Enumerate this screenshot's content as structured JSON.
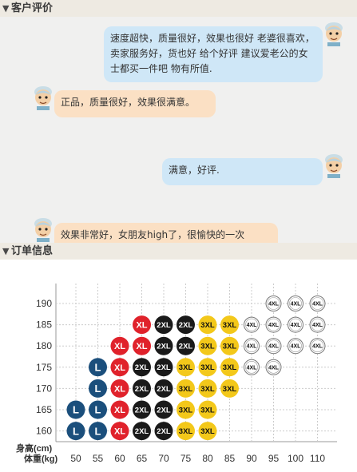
{
  "reviews_section": {
    "title": "客户评价"
  },
  "orders_section": {
    "title": "订单信息"
  },
  "reviews": [
    {
      "side": "right",
      "color": "blue",
      "text": "速度超快，质量很好，效果也很好 老婆很喜欢，卖家服务好，货也好 给个好评 建议爱老公的女士都买一件吧 物有所值."
    },
    {
      "side": "left",
      "color": "orange",
      "text": "正品，质量很好，效果很满意。"
    },
    {
      "side": "right",
      "color": "blue",
      "text": "满意，好评."
    },
    {
      "side": "left",
      "color": "orange",
      "text": "效果非常好，女朋友high了，很愉快的一次"
    }
  ],
  "chart_data": {
    "type": "table",
    "title": "",
    "xlabel": "体重(kg)",
    "ylabel": "身高(cm)",
    "x": [
      50,
      55,
      60,
      65,
      70,
      75,
      80,
      85,
      90,
      95,
      100,
      110
    ],
    "y": [
      160,
      165,
      170,
      175,
      180,
      185,
      190
    ],
    "size_colors": {
      "L": "#1b4f7c",
      "XL": "#e0222b",
      "2XL": "#1a1a1a",
      "3XL": "#f3c81a",
      "4XL": "#ffffff"
    },
    "rows": [
      {
        "height": 190,
        "sizes": [
          "",
          "",
          "",
          "",
          "",
          "",
          "",
          "",
          "",
          "4XL",
          "4XL",
          "4XL"
        ]
      },
      {
        "height": 185,
        "sizes": [
          "",
          "",
          "",
          "XL",
          "2XL",
          "2XL",
          "3XL",
          "3XL",
          "4XL",
          "4XL",
          "4XL",
          "4XL"
        ]
      },
      {
        "height": 180,
        "sizes": [
          "",
          "",
          "XL",
          "XL",
          "2XL",
          "2XL",
          "3XL",
          "3XL",
          "4XL",
          "4XL",
          "4XL",
          "4XL"
        ]
      },
      {
        "height": 175,
        "sizes": [
          "",
          "L",
          "XL",
          "2XL",
          "2XL",
          "3XL",
          "3XL",
          "3XL",
          "4XL",
          "4XL",
          "",
          ""
        ]
      },
      {
        "height": 170,
        "sizes": [
          "",
          "L",
          "XL",
          "2XL",
          "2XL",
          "3XL",
          "3XL",
          "3XL",
          "",
          "",
          "",
          ""
        ]
      },
      {
        "height": 165,
        "sizes": [
          "L",
          "L",
          "XL",
          "2XL",
          "2XL",
          "3XL",
          "3XL",
          "",
          "",
          "",
          "",
          ""
        ]
      },
      {
        "height": 160,
        "sizes": [
          "L",
          "L",
          "XL",
          "2XL",
          "2XL",
          "3XL",
          "3XL",
          "",
          "",
          "",
          "",
          ""
        ]
      }
    ]
  }
}
